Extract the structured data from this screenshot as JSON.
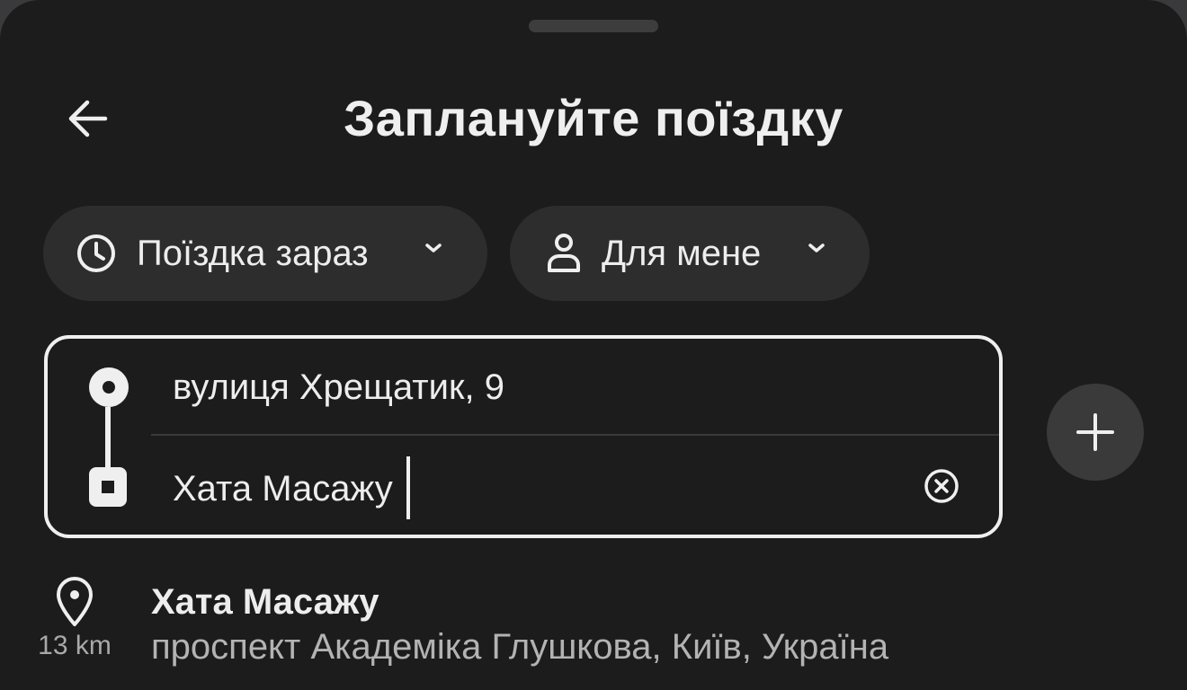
{
  "header": {
    "title": "Заплануйте поїздку",
    "back_icon": "arrow-left-icon"
  },
  "options": {
    "time": {
      "label": "Поїздка зараз",
      "icon": "clock-icon"
    },
    "rider": {
      "label": "Для мене",
      "icon": "person-icon"
    }
  },
  "route": {
    "pickup": "вулиця Хрещатик, 9",
    "destination": "Хата Масажу",
    "clear_icon": "clear-circle-icon",
    "add_stop_icon": "plus-icon"
  },
  "results": [
    {
      "name": "Хата Масажу",
      "address": "проспект Академіка Глушкова, Київ, Україна",
      "distance": "13 km",
      "icon": "location-pin-icon"
    }
  ],
  "colors": {
    "background": "#1c1c1c",
    "pill": "#2d2d2d",
    "text": "#ededed",
    "muted": "#b3b3b3"
  }
}
